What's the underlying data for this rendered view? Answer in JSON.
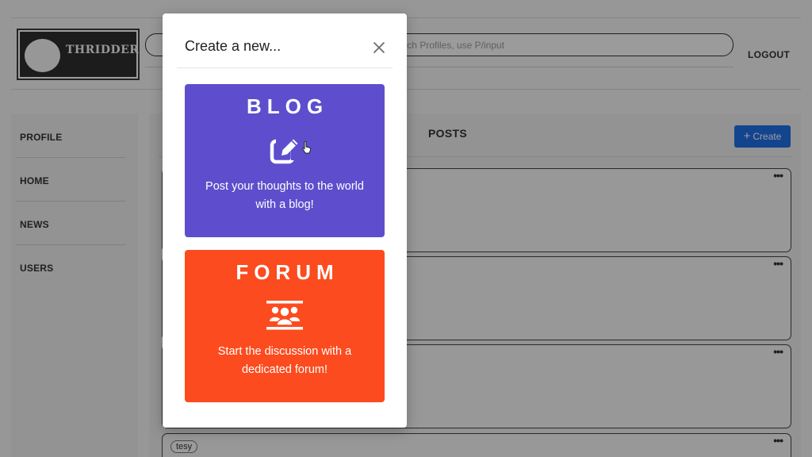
{
  "app": {
    "logo_text": "THRIDDER",
    "search_placeholder": "To Search Profiles, use P/input",
    "logout_label": "LOGOUT"
  },
  "sidebar": {
    "items": [
      {
        "label": "PROFILE"
      },
      {
        "label": "HOME"
      },
      {
        "label": "NEWS"
      },
      {
        "label": "USERS"
      }
    ]
  },
  "main": {
    "title": "POSTS",
    "create_label": "Create",
    "post_menu_label": "•••",
    "posts": [
      {
        "author": ""
      },
      {
        "author": ""
      },
      {
        "author": ""
      },
      {
        "author": "tesy"
      }
    ]
  },
  "modal": {
    "title": "Create a new...",
    "options": [
      {
        "heading": "BLOG",
        "icon": "edit-icon",
        "description": "Post your thoughts to the world with a blog!",
        "color": "#5e4ecd"
      },
      {
        "heading": "FORUM",
        "icon": "group-icon",
        "description": "Start the discussion with a dedicated forum!",
        "color": "#fc4b1e"
      }
    ]
  },
  "colors": {
    "primary_button": "#1f6fe5",
    "overlay": "rgba(0,0,0,0.38)"
  }
}
